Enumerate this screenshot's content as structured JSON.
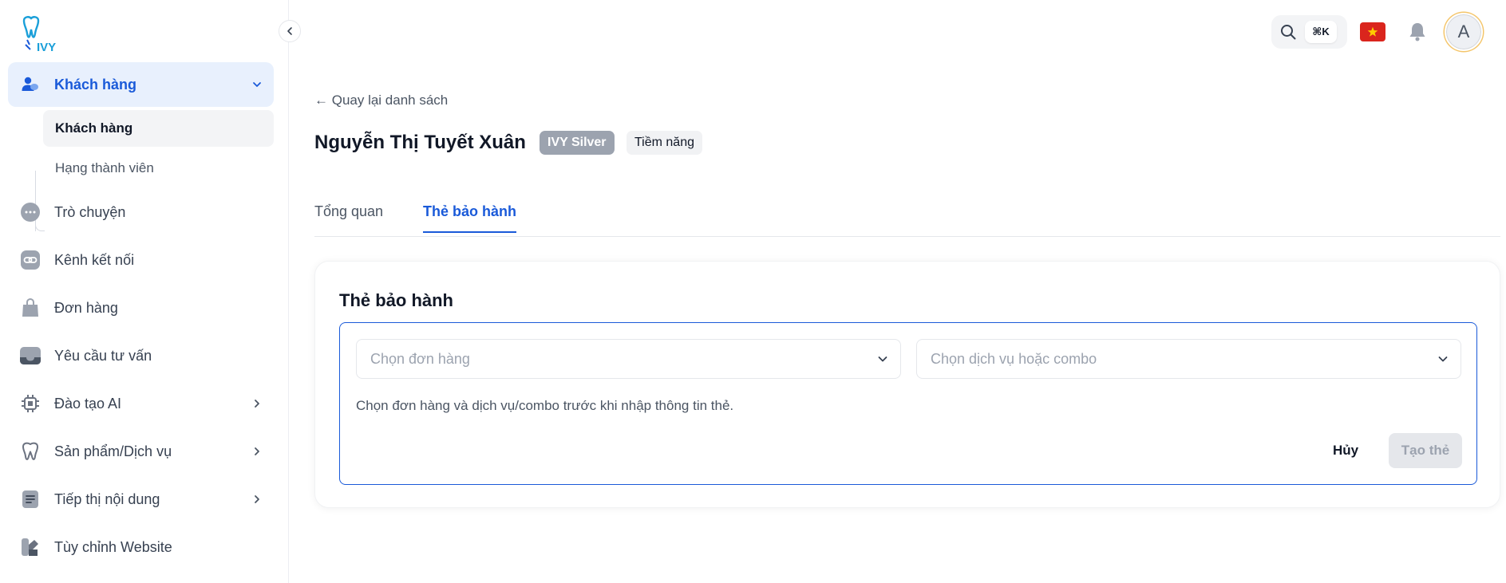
{
  "brand": {
    "logo_text": "IVY",
    "accent": "#1a5ad9"
  },
  "sidebar": {
    "items": [
      {
        "label": "Khách hàng",
        "icon": "users-icon",
        "active": true,
        "expanded": true
      },
      {
        "label": "Trò chuyện",
        "icon": "chat-icon"
      },
      {
        "label": "Kênh kết nối",
        "icon": "link-icon"
      },
      {
        "label": "Đơn hàng",
        "icon": "shopping-bag-icon"
      },
      {
        "label": "Yêu cầu tư vấn",
        "icon": "inbox-icon"
      },
      {
        "label": "Đào tạo AI",
        "icon": "chip-icon",
        "has_children": true
      },
      {
        "label": "Sản phẩm/Dịch vụ",
        "icon": "tooth-icon",
        "has_children": true
      },
      {
        "label": "Tiếp thị nội dung",
        "icon": "document-icon",
        "has_children": true
      },
      {
        "label": "Tùy chỉnh Website",
        "icon": "palette-icon"
      }
    ],
    "sub_items": [
      {
        "label": "Khách hàng",
        "active": true
      },
      {
        "label": "Hạng thành viên"
      }
    ]
  },
  "header": {
    "search_shortcut": "⌘K",
    "avatar_initial": "A",
    "language": "vi"
  },
  "main": {
    "back_link": "← Quay lại danh sách",
    "customer_name": "Nguyễn Thị Tuyết Xuân",
    "tier_badge": "IVY Silver",
    "status_badge": "Tiềm năng",
    "tabs": [
      {
        "label": "Tổng quan"
      },
      {
        "label": "Thẻ bảo hành",
        "active": true
      }
    ],
    "card": {
      "title": "Thẻ bảo hành",
      "order_select_placeholder": "Chọn đơn hàng",
      "service_select_placeholder": "Chọn dịch vụ hoặc combo",
      "hint": "Chọn đơn hàng và dịch vụ/combo trước khi nhập thông tin thẻ.",
      "cancel_label": "Hủy",
      "create_label": "Tạo thẻ"
    }
  }
}
